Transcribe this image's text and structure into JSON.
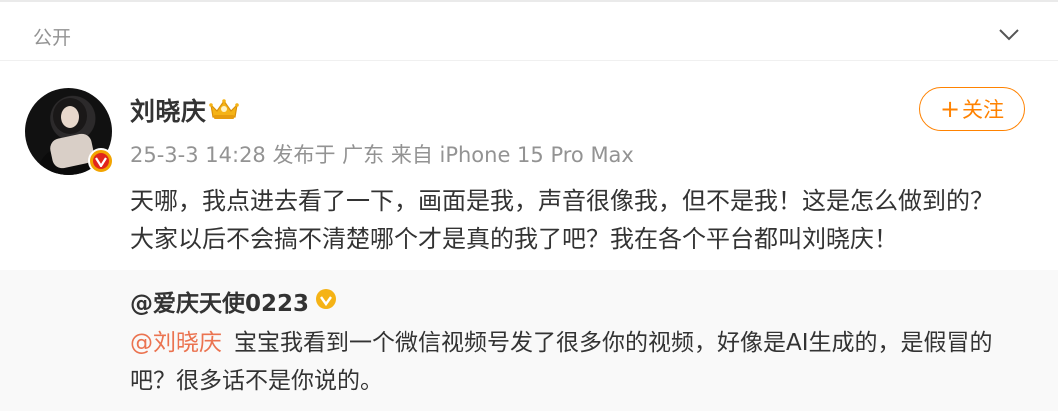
{
  "visibility": {
    "label": "公开"
  },
  "post": {
    "author": {
      "name": "刘晓庆"
    },
    "meta": "25-3-3 14:28 发布于 广东 来自 iPhone 15 Pro Max",
    "follow_label": "关注",
    "follow_plus": "+",
    "text_lines": [
      "天哪，我点进去看了一下，画面是我，声音很像我，但不是我！这是怎么做到的？",
      "大家以后不会搞不清楚哪个才是真的我了吧？我在各个平台都叫刘晓庆！"
    ]
  },
  "repost": {
    "author": "@爱庆天使0223",
    "mention": "@刘晓庆",
    "line1": "宝宝我看到一个微信视频号发了很多你的视频，好像是AI生成的，是假冒的",
    "line2": "吧？很多话不是你说的。"
  },
  "colors": {
    "accent": "#ff8200",
    "mention": "#eb7350",
    "meta": "#939393",
    "repost_bg": "#f9f9f9"
  },
  "icons": [
    "chevron-down-icon",
    "crown-icon",
    "verified-badge-icon",
    "gold-verified-icon"
  ]
}
